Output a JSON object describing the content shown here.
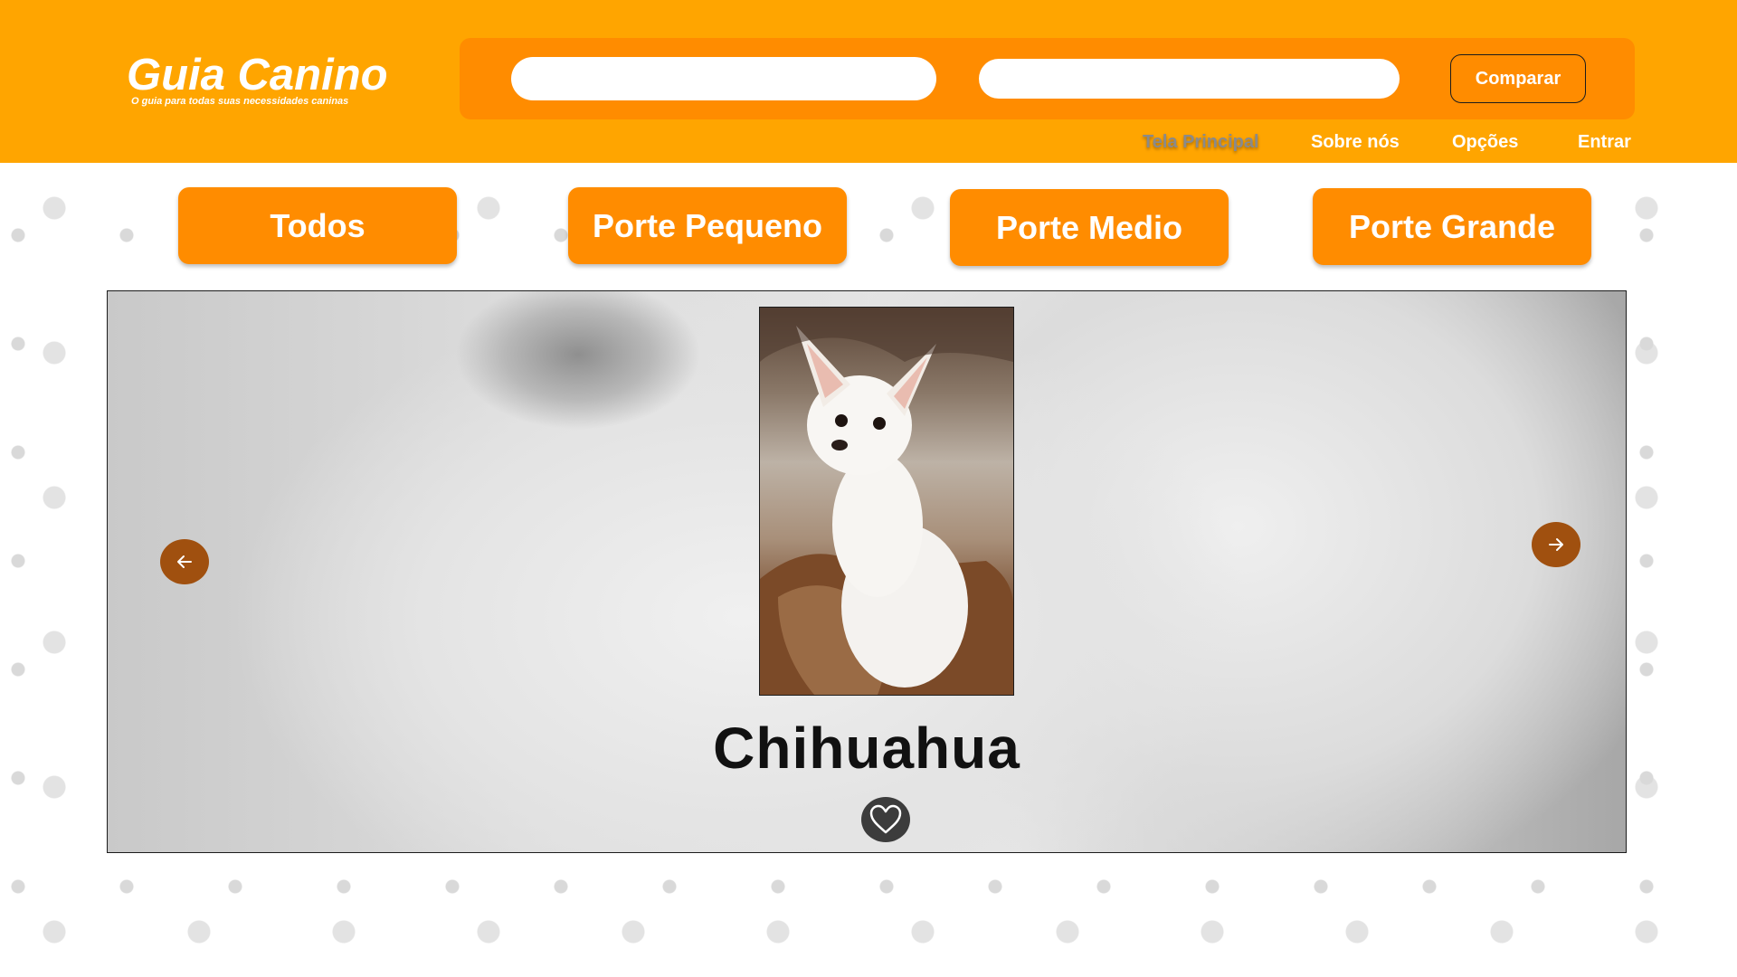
{
  "header": {
    "logo_title": "Guia Canino",
    "logo_tagline": "O guia para todas suas necessidades caninas",
    "search_one_placeholder": "",
    "search_two_placeholder": "",
    "compare_label": "Comparar",
    "nav": {
      "home": "Tela Principal",
      "about": "Sobre nós",
      "options": "Opções",
      "login": "Entrar"
    }
  },
  "filters": {
    "all": "Todos",
    "small": "Porte Pequeno",
    "medium": "Porte Medio",
    "large": "Porte Grande"
  },
  "carousel": {
    "breed_name": "Chihuahua",
    "prev_icon": "arrow-left-icon",
    "next_icon": "arrow-right-icon",
    "favorite_icon": "heart-icon"
  },
  "colors": {
    "header_bg": "#ffa500",
    "accent": "#ff8c00",
    "arrow_bg": "#a0500f",
    "favorite_bg": "#3c3c3c"
  }
}
